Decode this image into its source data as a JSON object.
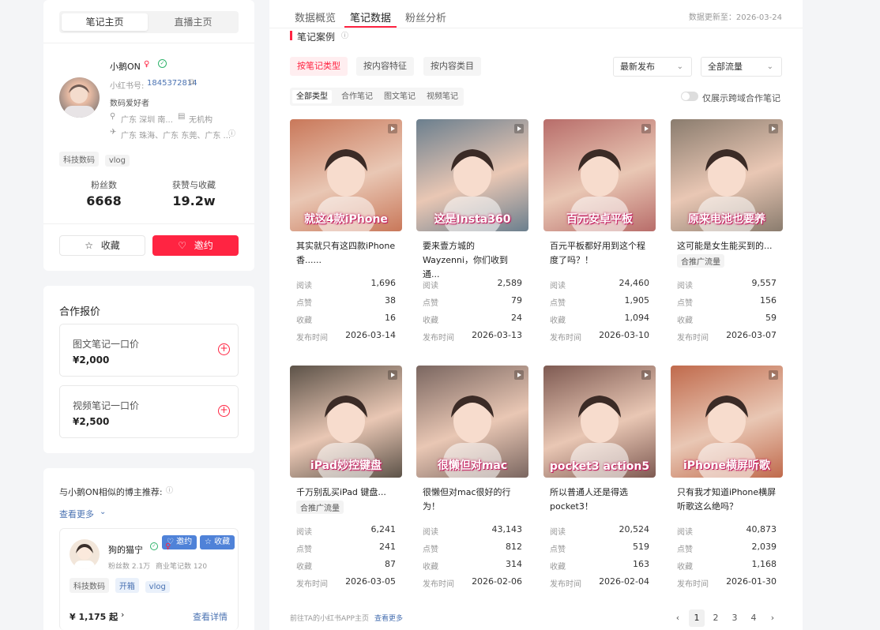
{
  "profile_tabs": [
    "笔记主页",
    "直播主页"
  ],
  "profile": {
    "name": "小鹅ON",
    "id_label": "小红书号:",
    "id_value": "1845372814",
    "bio": "数码爱好者",
    "location": "广东 深圳 南...",
    "org": "无机构",
    "cities": "广东 珠海、广东 东莞、广东 ...",
    "tags": [
      "科技数码",
      "vlog"
    ],
    "fans_label": "粉丝数",
    "fans_value": "6668",
    "likes_label": "获赞与收藏",
    "likes_value": "19.2w",
    "fav_button": "收藏",
    "invite_button": "邀约"
  },
  "pricing": {
    "title": "合作报价",
    "items": [
      {
        "label": "图文笔记一口价",
        "price": "¥2,000"
      },
      {
        "label": "视频笔记一口价",
        "price": "¥2,500"
      }
    ]
  },
  "similar": {
    "title": "与小鹅ON相似的博主推荐:",
    "more": "查看更多",
    "blogger": {
      "name": "狗的猫宁",
      "fans": "粉丝数 2.1万",
      "notes": "商业笔记数 120",
      "tags": [
        "科技数码",
        "开箱",
        "vlog"
      ],
      "price": "¥ 1,175 起",
      "detail": "查看详情",
      "invite": "邀约",
      "fav": "收藏"
    }
  },
  "main_tabs": [
    "数据概览",
    "笔记数据",
    "粉丝分析"
  ],
  "update_text": "数据更新至：2026-03-24",
  "section_title": "笔记案例",
  "filters": [
    "按笔记类型",
    "按内容特征",
    "按内容类目"
  ],
  "sort_dropdown": "最新发布",
  "traffic_dropdown": "全部流量",
  "subtabs": [
    "全部类型",
    "合作笔记",
    "图文笔记",
    "视频笔记"
  ],
  "toggle_label": "仅展示跨域合作笔记",
  "stat_labels": [
    "阅读",
    "点赞",
    "收藏",
    "发布时间"
  ],
  "notes": [
    {
      "title": "其实就只有这四款iPhone香......",
      "pill": "",
      "read": "1,696",
      "like": "38",
      "fav": "16",
      "date": "2026-03-14",
      "overlay": "就这4款iPhone",
      "color": "#c9785a"
    },
    {
      "title": "要来壹方城的Wayzenni，你们收到通...",
      "pill": "",
      "read": "2,589",
      "like": "79",
      "fav": "24",
      "date": "2026-03-13",
      "overlay": "这是Insta360",
      "color": "#6b7f8e"
    },
    {
      "title": "百元平板都好用到这个程度了吗？！",
      "pill": "",
      "read": "24,460",
      "like": "1,905",
      "fav": "1,094",
      "date": "2026-03-10",
      "overlay": "百元安卓平板",
      "color": "#b86d6a"
    },
    {
      "title": "这可能是女生能买到的...",
      "pill": "合推广流量",
      "read": "9,557",
      "like": "156",
      "fav": "59",
      "date": "2026-03-07",
      "overlay": "原来电池也要养",
      "color": "#8a7c6e"
    },
    {
      "title": "千万别乱买iPad 键盘...",
      "pill": "合推广流量",
      "read": "6,241",
      "like": "241",
      "fav": "87",
      "date": "2026-03-05",
      "overlay": "iPad妙控键盘",
      "color": "#5c5248"
    },
    {
      "title": "很懒但对mac很好的行为！",
      "pill": "",
      "read": "43,143",
      "like": "812",
      "fav": "314",
      "date": "2026-02-06",
      "overlay": "很懒但对mac",
      "color": "#7a6660"
    },
    {
      "title": "所以普通人还是得选pocket3！",
      "pill": "",
      "read": "20,524",
      "like": "519",
      "fav": "163",
      "date": "2026-02-04",
      "overlay": "pocket3 action5",
      "color": "#7e5a52"
    },
    {
      "title": "只有我才知道iPhone横屏听歌这么绝吗？",
      "pill": "",
      "read": "40,873",
      "like": "2,039",
      "fav": "1,168",
      "date": "2026-01-30",
      "overlay": "iPhone横屏听歌",
      "color": "#c06a4c"
    }
  ],
  "footer_link_text": "前往TA的小红书APP主页",
  "footer_more": "查看更多",
  "pages": [
    "1",
    "2",
    "3",
    "4"
  ]
}
